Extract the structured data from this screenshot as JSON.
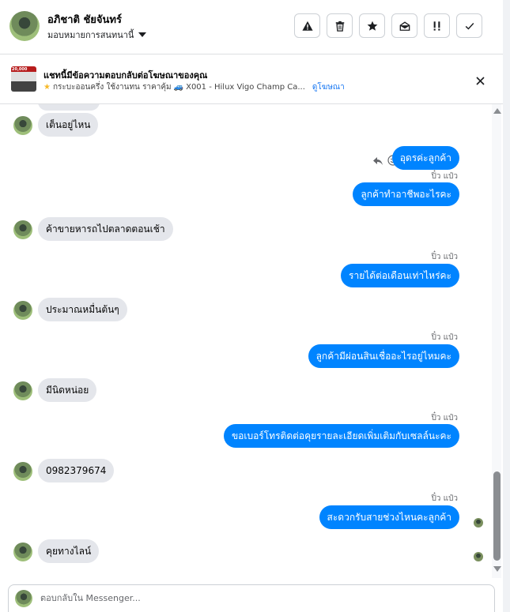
{
  "header": {
    "contact_name": "อภิชาติ ชัยจันทร์",
    "assign_label": "มอบหมายการสนทนานี้",
    "tools": [
      {
        "name": "spam-warning-icon"
      },
      {
        "name": "trash-icon"
      },
      {
        "name": "star-icon"
      },
      {
        "name": "mark-unread-icon"
      },
      {
        "name": "follow-up-icon"
      },
      {
        "name": "check-done-icon"
      }
    ]
  },
  "ad": {
    "thumb_badge": "20,000",
    "title": "แชทนี้มีข้อความตอบกลับต่อโฆษณาของคุณ",
    "line_text": "กระบะออนครึ่ง ใช้งานทน ราคาคุ้ม",
    "line_product": "X001 - Hilux Vigo Champ Ca...",
    "link": "ดูโฆษณา"
  },
  "messages": {
    "m1": "เต็นอยู่ไหน",
    "m2": "อุดรค่ะลูกค้า",
    "m3": "ลูกค้าทำอาชีพอะไรคะ",
    "m4": "ค้าขายหารถไปตลาดตอนเช้า",
    "m5": "รายได้ต่อเดือนเท่าไหร่คะ",
    "m6": "ประมาณหมื่นต้นๆ",
    "m7": "ลูกค้ามีผ่อนสินเชื่ออะไรอยู่ไหมคะ",
    "m8": "มีนิดหน่อย",
    "m9": "ขอเบอร์โทรติดต่อคุยรายละเอียดเพิ่มเติมกับเซลล์นะคะ",
    "m10": "0982379674",
    "m11": "สะดวกรับสายช่วงไหนคะลูกค้า",
    "m12": "คุยทางไลน์",
    "sender_name": "ปิ๋ว แป๋ว"
  },
  "composer": {
    "placeholder": "ตอบกลับใน Messenger..."
  },
  "colors": {
    "outgoing": "#0084ff",
    "incoming": "#e4e6eb",
    "link": "#1877f2"
  }
}
